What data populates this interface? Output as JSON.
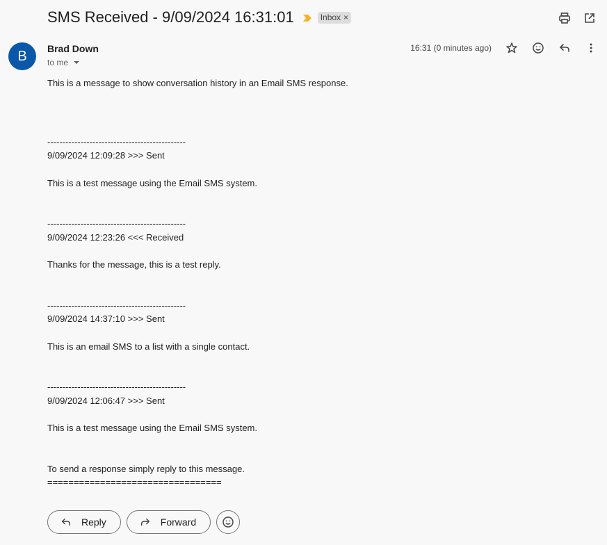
{
  "header": {
    "subject": "SMS Received - 9/09/2024 16:31:01",
    "label": "Inbox",
    "label_close": "×",
    "importance_color": "#f2b42c"
  },
  "top_actions": {
    "print_icon": "print-icon",
    "open_new_window_icon": "open-in-new-window-icon"
  },
  "message": {
    "avatar_letter": "B",
    "avatar_color": "#0b57a8",
    "sender": "Brad Down",
    "to": "to me",
    "timestamp": "16:31 (0 minutes ago)",
    "body": [
      "This is a message to show conversation history in an Email SMS response.",
      "----------------------------------------------",
      "9/09/2024 12:09:28 >>> Sent",
      "This is a test message using the Email SMS system.",
      "----------------------------------------------",
      "9/09/2024 12:23:26 <<< Received",
      "Thanks for the message, this is a test reply.",
      "----------------------------------------------",
      "9/09/2024 14:37:10 >>> Sent",
      "This is an email SMS to a list with a single contact.",
      "----------------------------------------------",
      "9/09/2024 12:06:47 >>> Sent",
      "This is a test message using the Email SMS system.",
      "To send a response simply reply to this message.",
      "================================="
    ]
  },
  "footer": {
    "reply_label": "Reply",
    "forward_label": "Forward"
  }
}
